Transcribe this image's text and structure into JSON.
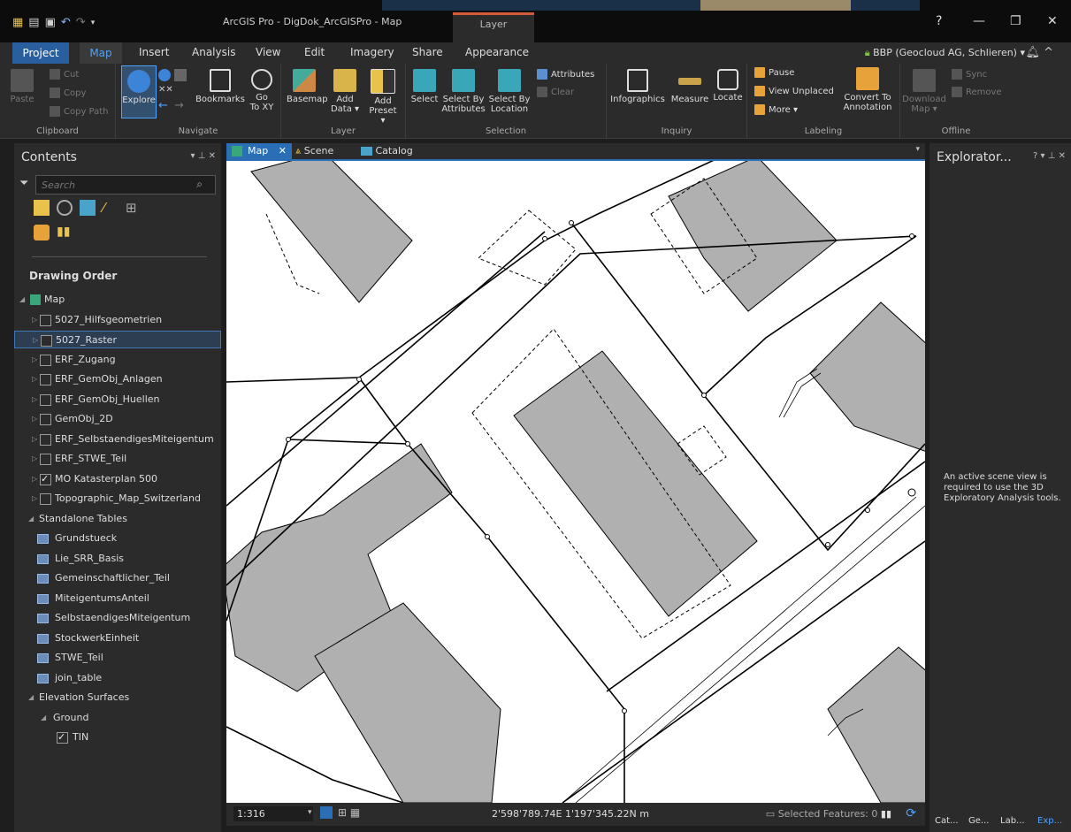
{
  "window": {
    "title": "ArcGIS Pro - DigDok_ArcGISPro - Map",
    "context_tab_group": "Layer",
    "help": "?",
    "minimize": "—",
    "restore": "❐",
    "close": "✕"
  },
  "ribbon_tabs": {
    "project": "Project",
    "map": "Map",
    "insert": "Insert",
    "analysis": "Analysis",
    "view": "View",
    "edit": "Edit",
    "imagery": "Imagery",
    "share": "Share",
    "appearance": "Appearance"
  },
  "user": "BBP (Geocloud AG, Schlieren) ▾",
  "ribbon": {
    "clipboard": {
      "label": "Clipboard",
      "paste": "Paste",
      "cut": "Cut",
      "copy": "Copy",
      "copy_path": "Copy Path"
    },
    "navigate": {
      "label": "Navigate",
      "explore": "Explore",
      "bookmarks": "Bookmarks",
      "go_to_xy_1": "Go",
      "go_to_xy_2": "To XY"
    },
    "layer": {
      "label": "Layer",
      "basemap": "Basemap",
      "add_data_1": "Add",
      "add_data_2": "Data ▾",
      "add_preset_1": "Add",
      "add_preset_2": "Preset ▾"
    },
    "selection": {
      "label": "Selection",
      "select": "Select",
      "select_by_attr_1": "Select By",
      "select_by_attr_2": "Attributes",
      "select_by_loc_1": "Select By",
      "select_by_loc_2": "Location",
      "attributes": "Attributes",
      "clear": "Clear"
    },
    "inquiry": {
      "label": "Inquiry",
      "infographics": "Infographics",
      "measure": "Measure",
      "locate": "Locate"
    },
    "labeling": {
      "label": "Labeling",
      "pause": "Pause",
      "view_unplaced": "View Unplaced",
      "more": "More ▾",
      "convert_1": "Convert To",
      "convert_2": "Annotation"
    },
    "offline": {
      "label": "Offline",
      "download_1": "Download",
      "download_2": "Map ▾",
      "sync": "Sync",
      "remove": "Remove"
    }
  },
  "contents": {
    "title": "Contents",
    "panel_controls": "▾ ⊥ ✕",
    "search_placeholder": "Search",
    "drawing_order": "Drawing Order",
    "map_label": "Map",
    "layers": [
      {
        "name": "5027_Hilfsgeometrien",
        "checked": false
      },
      {
        "name": "5027_Raster",
        "checked": false,
        "selected": true
      },
      {
        "name": "ERF_Zugang",
        "checked": false
      },
      {
        "name": "ERF_GemObj_Anlagen",
        "checked": false
      },
      {
        "name": "ERF_GemObj_Huellen",
        "checked": false
      },
      {
        "name": "GemObj_2D",
        "checked": false
      },
      {
        "name": "ERF_SelbstaendigesMiteigentum",
        "checked": false
      },
      {
        "name": "ERF_STWE_Teil",
        "checked": false
      },
      {
        "name": "MO Katasterplan 500",
        "checked": true
      },
      {
        "name": "Topographic_Map_Switzerland",
        "checked": false
      }
    ],
    "standalone_tables_label": "Standalone Tables",
    "tables": [
      "Grundstueck",
      "Lie_SRR_Basis",
      "Gemeinschaftlicher_Teil",
      "MiteigentumsAnteil",
      "SelbstaendigesMiteigentum",
      "StockwerkEinheit",
      "STWE_Teil",
      "join_table"
    ],
    "elevation_label": "Elevation Surfaces",
    "ground_label": "Ground",
    "tin_label": "TIN"
  },
  "map_tabs": {
    "map": "Map",
    "scene": "Scene",
    "catalog": "Catalog"
  },
  "status": {
    "scale": "1:316",
    "coordinates": "2'598'789.74E 1'197'345.22N m",
    "selected_features": "Selected Features: 0"
  },
  "explorator": {
    "title": "Explorator...",
    "controls": "? ▾ ⊥ ✕",
    "message": "An active scene view is required to use the 3D Exploratory Analysis tools.",
    "tabs": [
      "Cat...",
      "Ge...",
      "Lab...",
      "Exp..."
    ]
  },
  "colors": {
    "accent": "#2a6fb5",
    "building": "#b0b0b0",
    "selected_row": "#2d3d52"
  }
}
